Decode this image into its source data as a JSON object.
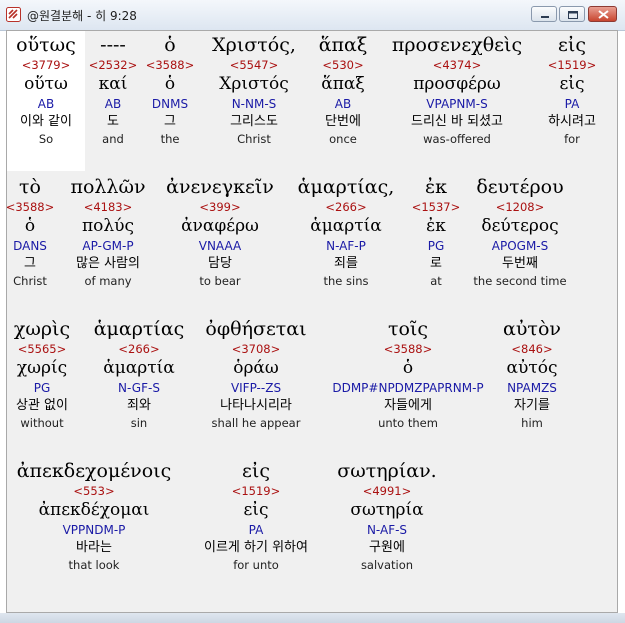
{
  "window": {
    "title": "@원결분해 - 히 9:28",
    "minimize_label": "minimize",
    "maximize_label": "maximize",
    "close_label": "close"
  },
  "rows": [
    {
      "words": [
        {
          "greek": "οὕτως",
          "strong": "<3779>",
          "lemma": "οὕτω",
          "parse": "AB",
          "korean": "이와 같이",
          "english": "So"
        },
        {
          "greek": "----",
          "strong": "<2532>",
          "lemma": "καί",
          "parse": "AB",
          "korean": "도",
          "english": "and"
        },
        {
          "greek": "ὁ",
          "strong": "<3588>",
          "lemma": "ὁ",
          "parse": "DNMS",
          "korean": "그",
          "english": "the"
        },
        {
          "greek": "Χριστός,",
          "strong": "<5547>",
          "lemma": "Χριστός",
          "parse": "N-NM-S",
          "korean": "그리스도",
          "english": "Christ"
        },
        {
          "greek": "ἅπαξ",
          "strong": "<530>",
          "lemma": "ἅπαξ",
          "parse": "AB",
          "korean": "단번에",
          "english": "once"
        },
        {
          "greek": "προσενεχθεὶς",
          "strong": "<4374>",
          "lemma": "προσφέρω",
          "parse": "VPAPNM-S",
          "korean": "드리신 바 되셨고",
          "english": "was-offered"
        },
        {
          "greek": "εἰς",
          "strong": "<1519>",
          "lemma": "εἰς",
          "parse": "PA",
          "korean": "하시려고",
          "english": "for"
        }
      ]
    },
    {
      "words": [
        {
          "greek": "τὸ",
          "strong": "<3588>",
          "lemma": "ὁ",
          "parse": "DANS",
          "korean": "그",
          "english": "Christ"
        },
        {
          "greek": "πολλῶν",
          "strong": "<4183>",
          "lemma": "πολύς",
          "parse": "AP-GM-P",
          "korean": "많은 사람의",
          "english": "of many"
        },
        {
          "greek": "ἀνενεγκεῖν",
          "strong": "<399>",
          "lemma": "ἀναφέρω",
          "parse": "VNAAA",
          "korean": "담당",
          "english": "to bear"
        },
        {
          "greek": "ἁμαρτίας,",
          "strong": "<266>",
          "lemma": "ἁμαρτία",
          "parse": "N-AF-P",
          "korean": "죄를",
          "english": "the sins"
        },
        {
          "greek": "ἐκ",
          "strong": "<1537>",
          "lemma": "ἐκ",
          "parse": "PG",
          "korean": "로",
          "english": "at"
        },
        {
          "greek": "δευτέρου",
          "strong": "<1208>",
          "lemma": "δεύτερος",
          "parse": "APOGM-S",
          "korean": "두번째",
          "english": "the second time"
        }
      ]
    },
    {
      "words": [
        {
          "greek": "χωρὶς",
          "strong": "<5565>",
          "lemma": "χωρίς",
          "parse": "PG",
          "korean": "상관 없이",
          "english": "without"
        },
        {
          "greek": "ἁμαρτίας",
          "strong": "<266>",
          "lemma": "ἁμαρτία",
          "parse": "N-GF-S",
          "korean": "죄와",
          "english": "sin"
        },
        {
          "greek": "ὀφθήσεται",
          "strong": "<3708>",
          "lemma": "ὁράω",
          "parse": "VIFP--ZS",
          "korean": "나타나시리라",
          "english": "shall he appear"
        },
        {
          "greek": "τοῖς",
          "strong": "<3588>",
          "lemma": "ὁ",
          "parse": "DDMP#NPDMZPAPRNM-P",
          "korean": "자들에게",
          "english": "unto them"
        },
        {
          "greek": "αὐτὸν",
          "strong": "<846>",
          "lemma": "αὐτός",
          "parse": "NPAMZS",
          "korean": "자기를",
          "english": "him"
        }
      ]
    },
    {
      "words": [
        {
          "greek": "ἀπεκδεχομένοις",
          "strong": "<553>",
          "lemma": "ἀπεκδέχομαι",
          "parse": "VPPNDM-P",
          "korean": "바라는",
          "english": "that look"
        },
        {
          "greek": "εἰς",
          "strong": "<1519>",
          "lemma": "εἰς",
          "parse": "PA",
          "korean": "이르게 하기 위하여",
          "english": "for unto"
        },
        {
          "greek": "σωτηρίαν.",
          "strong": "<4991>",
          "lemma": "σωτηρία",
          "parse": "N-AF-S",
          "korean": "구원에",
          "english": "salvation"
        }
      ]
    }
  ]
}
